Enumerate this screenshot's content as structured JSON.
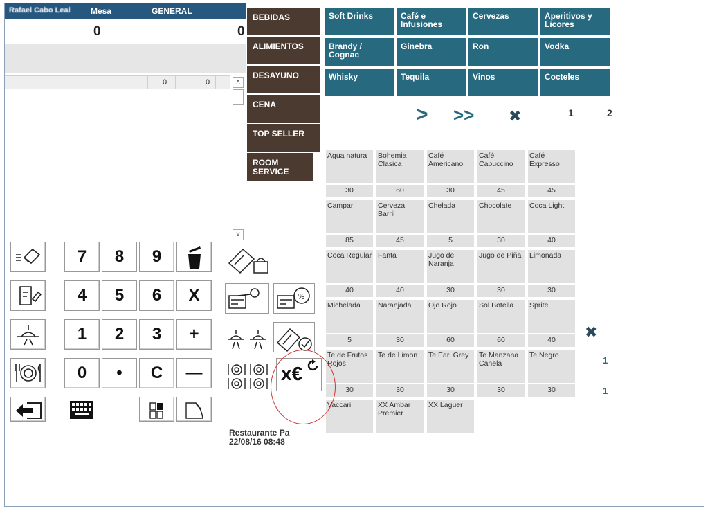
{
  "order": {
    "waiter": "Rafael Cabo Leal",
    "table_label": "Mesa",
    "section": "GENERAL",
    "count_left": "0",
    "count_right": "0",
    "qty_a": "0",
    "qty_b": "0"
  },
  "categories": [
    "BEBIDAS",
    "ALIMIENTOS",
    "DESAYUNO",
    "CENA",
    "TOP SELLER",
    "ROOM SERVICE"
  ],
  "subcategories": [
    "Soft Drinks",
    "Café e Infusiones",
    "Cervezas",
    "Aperitivos y Licores",
    "Brandy / Cognac",
    "Ginebra",
    "Ron",
    "Vodka",
    "Whisky",
    "Tequila",
    "Vinos",
    "Cocteles"
  ],
  "nav": {
    "next": ">",
    "last": ">>",
    "close": "✖",
    "page1": "1",
    "page2": "2"
  },
  "products": [
    {
      "name": "Agua natura",
      "price": "30"
    },
    {
      "name": "Bohemia Clasica",
      "price": "60"
    },
    {
      "name": "Café Americano",
      "price": "30"
    },
    {
      "name": "Café Capuccino",
      "price": "45"
    },
    {
      "name": "Café Expresso",
      "price": "45"
    },
    {
      "name": "Campari",
      "price": "85"
    },
    {
      "name": "Cerveza Barril",
      "price": "45"
    },
    {
      "name": "Chelada",
      "price": "5"
    },
    {
      "name": "Chocolate",
      "price": "30"
    },
    {
      "name": "Coca Light",
      "price": "40"
    },
    {
      "name": "Coca Regular",
      "price": "40"
    },
    {
      "name": "Fanta",
      "price": "40"
    },
    {
      "name": "Jugo de Naranja",
      "price": "30"
    },
    {
      "name": "Jugo de Piña",
      "price": "30"
    },
    {
      "name": "Limonada",
      "price": "30"
    },
    {
      "name": "Michelada",
      "price": "5"
    },
    {
      "name": "Naranjada",
      "price": "30"
    },
    {
      "name": "Ojo Rojo",
      "price": "60"
    },
    {
      "name": "Sol Botella",
      "price": "60"
    },
    {
      "name": "Sprite",
      "price": "40"
    },
    {
      "name": "Te de Frutos Rojos",
      "price": "30"
    },
    {
      "name": "Te de Limon",
      "price": "30"
    },
    {
      "name": "Te Earl Grey",
      "price": "30"
    },
    {
      "name": "Te Manzana Canela",
      "price": "30"
    },
    {
      "name": "Te Negro",
      "price": "30"
    },
    {
      "name": "Vaccari",
      "price": ""
    },
    {
      "name": "XX Ambar Premier",
      "price": ""
    },
    {
      "name": "XX Laguer",
      "price": ""
    }
  ],
  "side_panel": {
    "close": "✖",
    "num1": "1",
    "num2": "1"
  },
  "keypad": {
    "k7": "7",
    "k8": "8",
    "k9": "9",
    "k4": "4",
    "k5": "5",
    "k6": "6",
    "kx": "X",
    "k1": "1",
    "k2": "2",
    "k3": "3",
    "kplus": "+",
    "k0": "0",
    "kdot": "•",
    "kc": "C",
    "kminus": "—"
  },
  "currency_button": {
    "label": "x€"
  },
  "footer": {
    "restaurant": "Restaurante Pa",
    "datetime": "22/08/16 08:48"
  },
  "colors": {
    "header": "#26577e",
    "category": "#4b3a30",
    "subcategory": "#276a80",
    "highlight": "#d9302c"
  }
}
